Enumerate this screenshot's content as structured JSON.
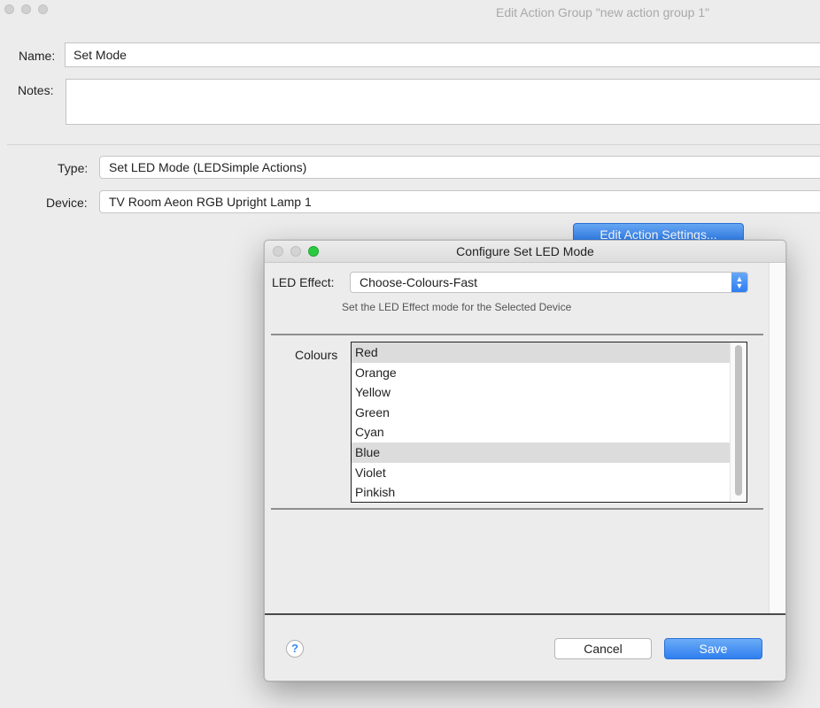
{
  "window": {
    "title": "Edit Action Group \"new action group 1\""
  },
  "form": {
    "name_label": "Name:",
    "name_value": "Set Mode",
    "notes_label": "Notes:",
    "notes_value": "",
    "type_label": "Type:",
    "type_value": "Set LED Mode (LEDSimple Actions)",
    "device_label": "Device:",
    "device_value": "TV Room Aeon RGB Upright Lamp 1",
    "edit_settings_label": "Edit Action Settings..."
  },
  "dialog": {
    "title": "Configure Set LED Mode",
    "led_effect_label": "LED Effect:",
    "led_effect_value": "Choose-Colours-Fast",
    "hint": "Set the LED Effect mode for the Selected Device",
    "colours_label": "Colours",
    "colours": [
      {
        "label": "Red",
        "selected": true
      },
      {
        "label": "Orange",
        "selected": false
      },
      {
        "label": "Yellow",
        "selected": false
      },
      {
        "label": "Green",
        "selected": false
      },
      {
        "label": "Cyan",
        "selected": false
      },
      {
        "label": "Blue",
        "selected": true
      },
      {
        "label": "Violet",
        "selected": false
      },
      {
        "label": "Pinkish",
        "selected": false
      }
    ],
    "help_label": "?",
    "cancel_label": "Cancel",
    "save_label": "Save"
  },
  "colors": {
    "accent": "#2f7ff0",
    "window_bg": "#ececec",
    "selection": "#dcdcdc",
    "zoom_button": "#2ccb3f"
  }
}
